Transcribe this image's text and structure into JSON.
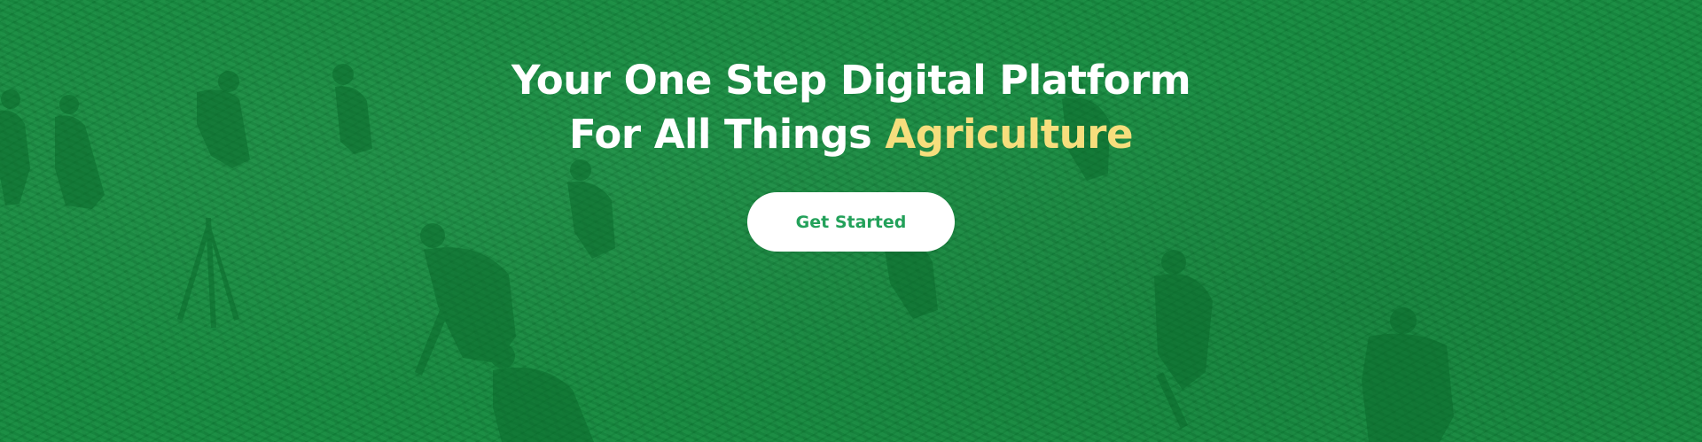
{
  "hero": {
    "headline_line1": "Your One Step Digital Platform",
    "headline_line2_prefix": "For All Things ",
    "headline_highlight": "Agriculture",
    "cta_label": "Get Started"
  },
  "colors": {
    "background": "#138a3d",
    "headline": "#ffffff",
    "highlight": "#f6de7d",
    "cta_background": "#ffffff",
    "cta_text": "#23a15a"
  }
}
